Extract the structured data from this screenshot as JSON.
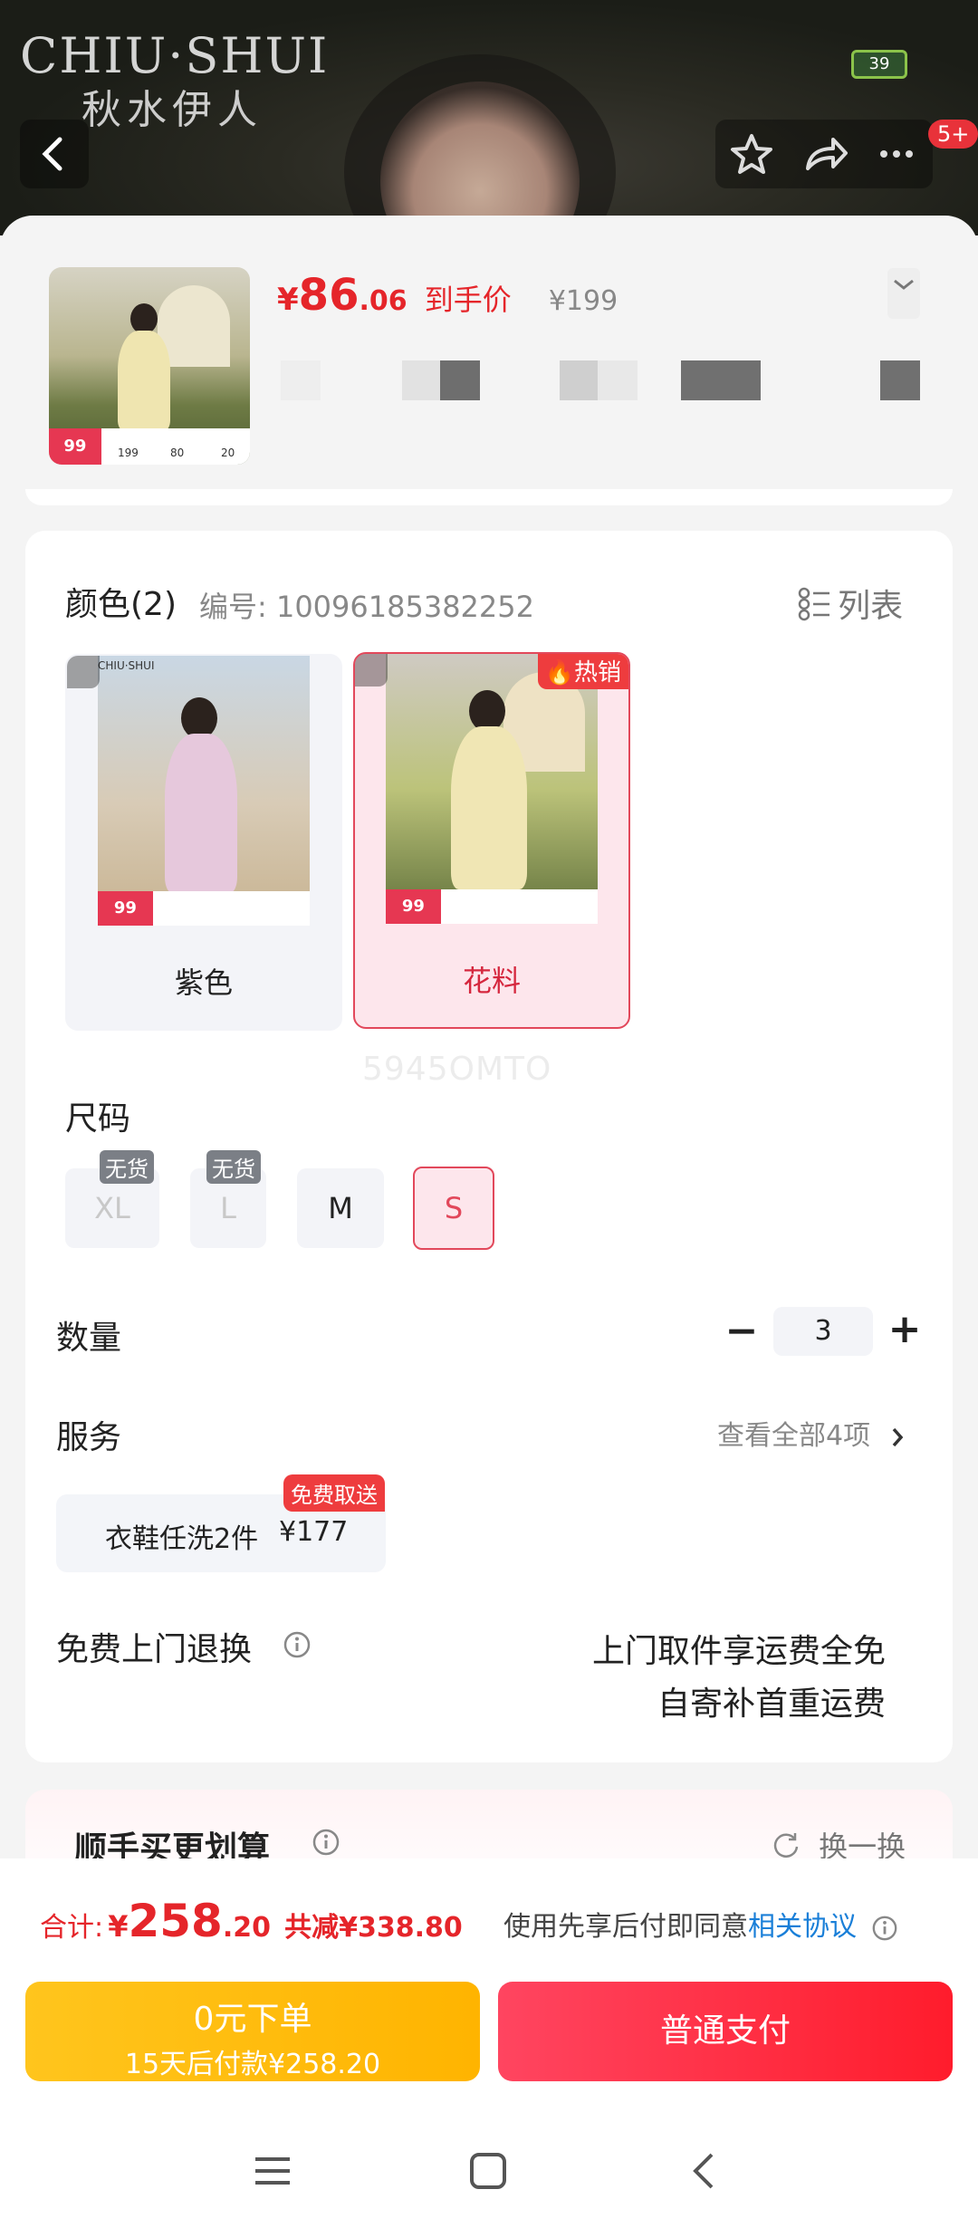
{
  "header": {
    "brand_en": "CHIU·SHUI",
    "brand_cn": "秋水伊人",
    "battery": "39",
    "notification_badge": "5+"
  },
  "product": {
    "currency": "¥",
    "price_int": "86",
    "price_dec": ".06",
    "price_label": "到手价",
    "original_price": "¥199",
    "thumb_price": "99",
    "thumb_prices": [
      "199",
      "80",
      "20"
    ]
  },
  "color": {
    "title": "颜色(2)",
    "code_label": "编号: 10096185382252",
    "list_label": "列表",
    "options": [
      {
        "label": "紫色",
        "brand": "CHIU·SHUI"
      },
      {
        "label": "花料",
        "hot": "热销"
      }
    ],
    "watermark": "5945OMTO"
  },
  "size": {
    "title": "尺码",
    "options": [
      {
        "label": "XL",
        "tag": "无货"
      },
      {
        "label": "L",
        "tag": "无货"
      },
      {
        "label": "M"
      },
      {
        "label": "S"
      }
    ]
  },
  "quantity": {
    "title": "数量",
    "value": "3",
    "minus": "−",
    "plus": "+"
  },
  "service": {
    "title": "服务",
    "view_all": "查看全部4项",
    "item_label": "衣鞋任洗2件",
    "item_price": "¥177",
    "item_tag": "免费取送"
  },
  "returns": {
    "title": "免费上门退换",
    "line1": "上门取件享运费全免",
    "line2": "自寄补首重运费"
  },
  "recommend": {
    "title": "顺手买更划算",
    "refresh": "换一换"
  },
  "summary": {
    "total_label": "合计:",
    "currency": "¥",
    "total_int": "258",
    "total_dec": ".20",
    "discount": "共减¥338.80",
    "agree_text": "使用先享后付即同意",
    "agree_link": "相关协议"
  },
  "actions": {
    "later_title": "0元下单",
    "later_sub": "15天后付款¥258.20",
    "pay_now": "普通支付"
  },
  "colors": {
    "accent_red": "#e5252a",
    "link_blue": "#1a7fd8",
    "button_yellow": "#ffbb12",
    "button_red": "#ff2c3d"
  }
}
